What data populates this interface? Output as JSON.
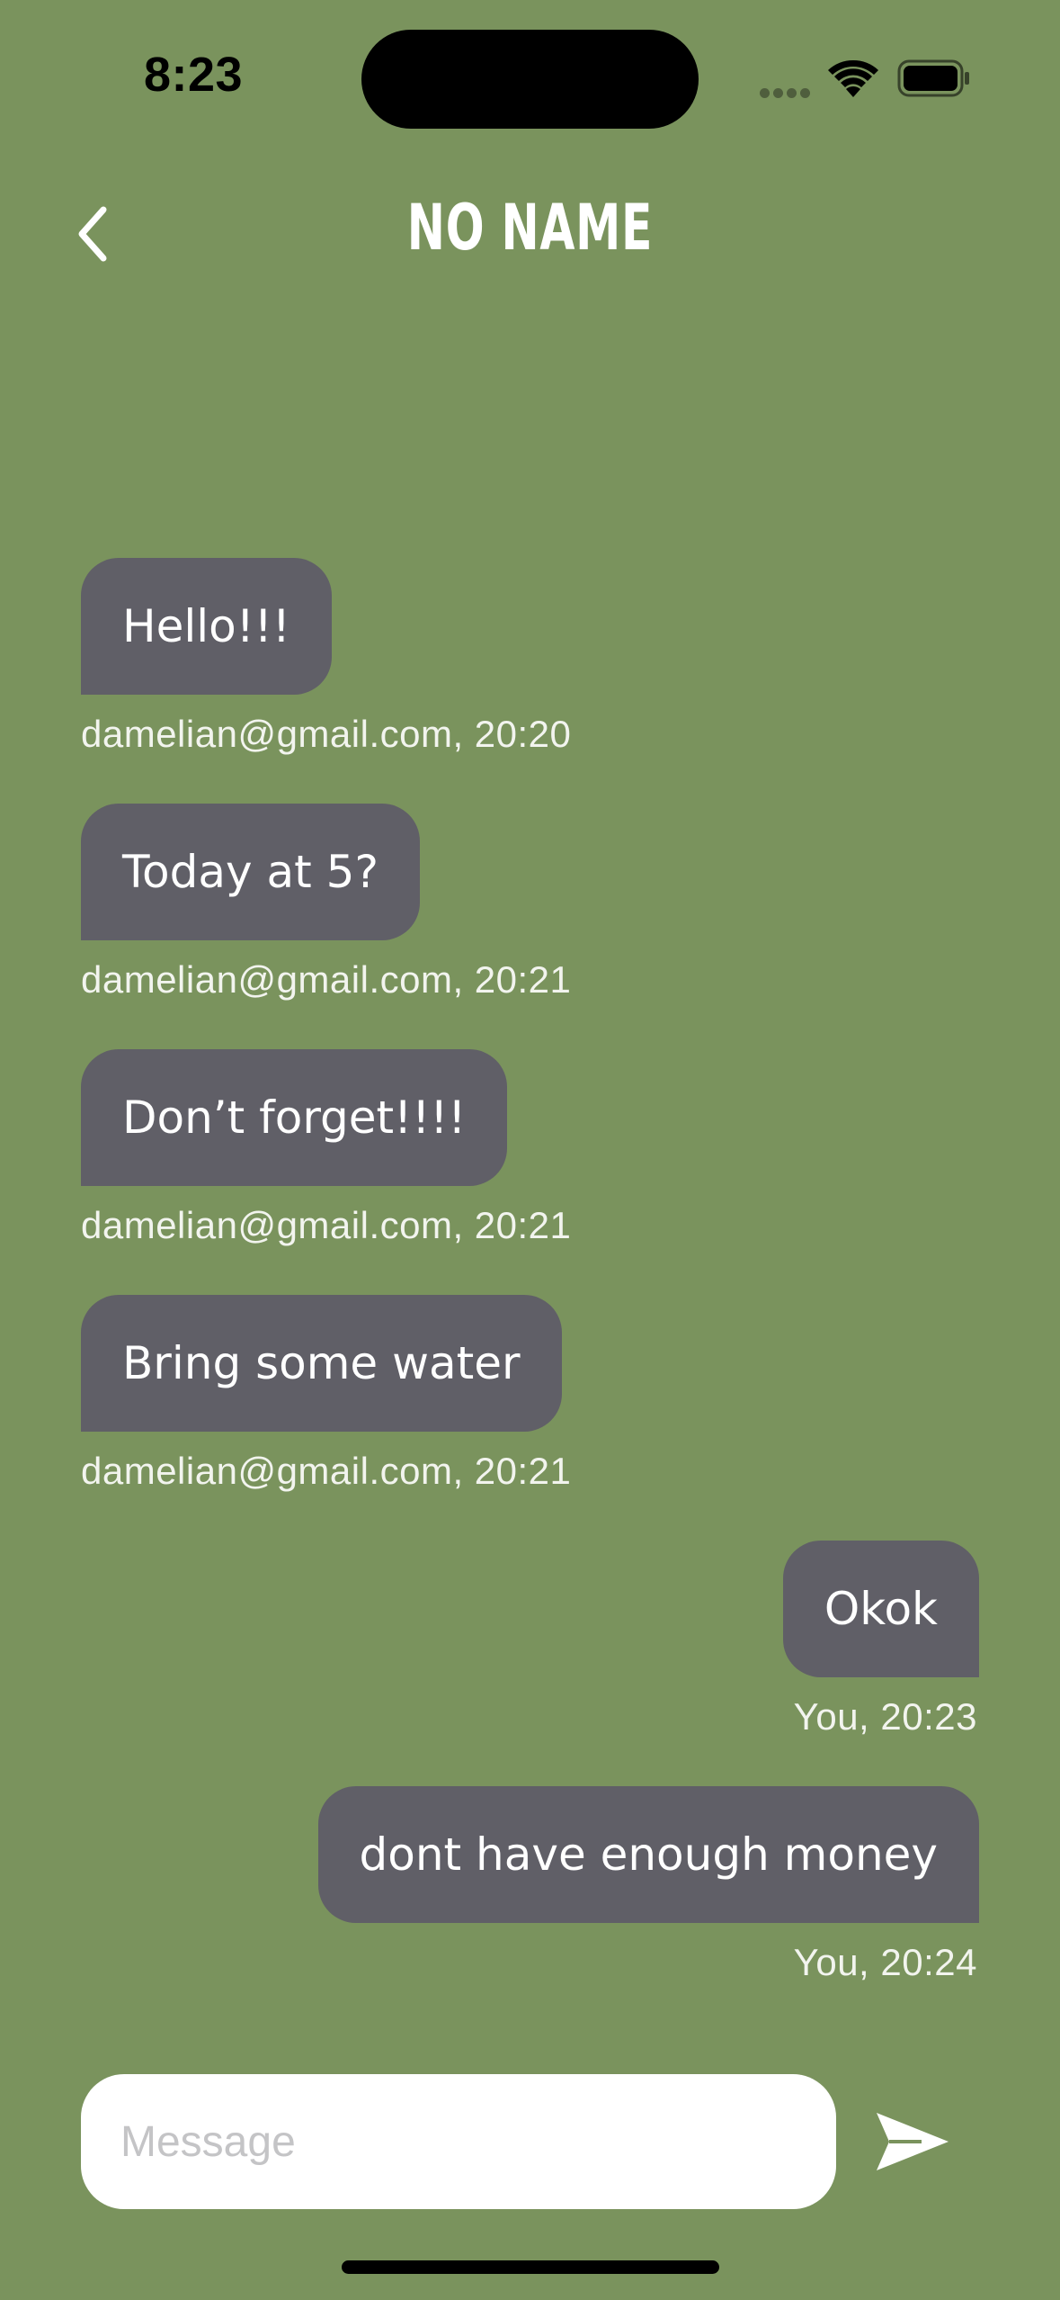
{
  "status_bar": {
    "time": "8:23"
  },
  "header": {
    "title": "NO NAME",
    "back_icon": "chevron-left-icon"
  },
  "messages": [
    {
      "direction": "incoming",
      "text": "Hello!!!",
      "meta": "damelian@gmail.com, 20:20"
    },
    {
      "direction": "incoming",
      "text": "Today at 5?",
      "meta": "damelian@gmail.com, 20:21"
    },
    {
      "direction": "incoming",
      "text": "Don’t forget!!!!",
      "meta": "damelian@gmail.com, 20:21"
    },
    {
      "direction": "incoming",
      "text": "Bring some water",
      "meta": "damelian@gmail.com, 20:21"
    },
    {
      "direction": "outgoing",
      "text": "Okok",
      "meta": "You, 20:23"
    },
    {
      "direction": "outgoing",
      "text": "dont have enough money",
      "meta": "You, 20:24"
    }
  ],
  "composer": {
    "placeholder": "Message",
    "value": "",
    "send_icon": "send-icon"
  },
  "colors": {
    "background": "#7a935d",
    "bubble": "#605f67",
    "text": "#ffffff"
  }
}
